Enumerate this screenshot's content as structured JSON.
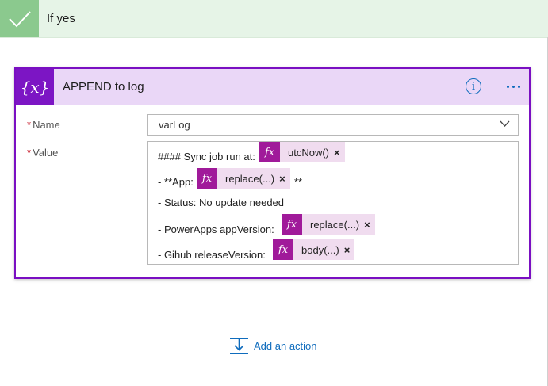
{
  "header": {
    "title": "If yes",
    "accent": "#8bc98e",
    "background": "#e6f4e7"
  },
  "card": {
    "title": "APPEND to log",
    "icon_text": "{x}",
    "accent": "#7c15c4",
    "name": {
      "label": "Name",
      "required_mark": "*",
      "value": "varLog"
    },
    "value": {
      "label": "Value",
      "required_mark": "*",
      "lines": [
        {
          "prefix": "#### Sync job run at:",
          "token": "utcNow()",
          "suffix": ""
        },
        {
          "prefix": "- **App:",
          "token": "replace(...)",
          "suffix": "**"
        },
        {
          "prefix": "- Status: No update needed",
          "token": null,
          "suffix": ""
        },
        {
          "prefix": "- PowerApps appVersion:",
          "token": "replace(...)",
          "suffix": ""
        },
        {
          "prefix": "- Gihub releaseVersion:",
          "token": "body(...)",
          "suffix": ""
        }
      ],
      "token_icon": "fx",
      "token_close": "×"
    }
  },
  "footer": {
    "add_action_label": "Add an action"
  },
  "icons": [
    "checkmark-icon",
    "variable-icon",
    "info-icon",
    "more-options-icon",
    "chevron-down-icon",
    "fx-icon",
    "close-icon",
    "add-action-icon"
  ]
}
